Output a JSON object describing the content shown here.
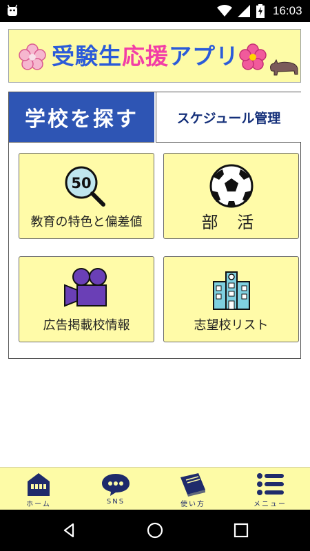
{
  "status_bar": {
    "time": "16:03",
    "icons": [
      "android-icon",
      "wifi-icon",
      "signal-icon",
      "battery-charging-icon"
    ]
  },
  "banner": {
    "title_part1": "受験生",
    "title_part2": "応援",
    "title_part3": "アプリ",
    "icons": [
      "cherry-blossom-icon",
      "rhino-icon"
    ],
    "colors": {
      "background": "#fdfba6",
      "blue": "#2b5bd9",
      "pink": "#f23ea6"
    }
  },
  "tabs": [
    {
      "label": "学校を探す",
      "active": true
    },
    {
      "label": "スケジュール管理",
      "active": false
    }
  ],
  "tiles": [
    {
      "label": "教育の特色と偏差値",
      "icon": "magnifier-50-icon"
    },
    {
      "label": "部 活",
      "icon": "soccer-ball-icon"
    },
    {
      "label": "広告掲載校情報",
      "icon": "video-camera-icon"
    },
    {
      "label": "志望校リスト",
      "icon": "school-building-icon"
    }
  ],
  "tile_badge": "50",
  "bottom_nav": [
    {
      "label": "ホーム",
      "icon": "home-icon"
    },
    {
      "label": "SNS",
      "icon": "chat-bubble-icon"
    },
    {
      "label": "使い方",
      "icon": "book-icon"
    },
    {
      "label": "メニュー",
      "icon": "menu-list-icon"
    }
  ],
  "system_nav": [
    "back-icon",
    "home-circle-icon",
    "recents-icon"
  ],
  "colors": {
    "tab_active": "#2e55b4",
    "tile_bg": "#fffba8",
    "nav_icon": "#1f2b6b"
  }
}
